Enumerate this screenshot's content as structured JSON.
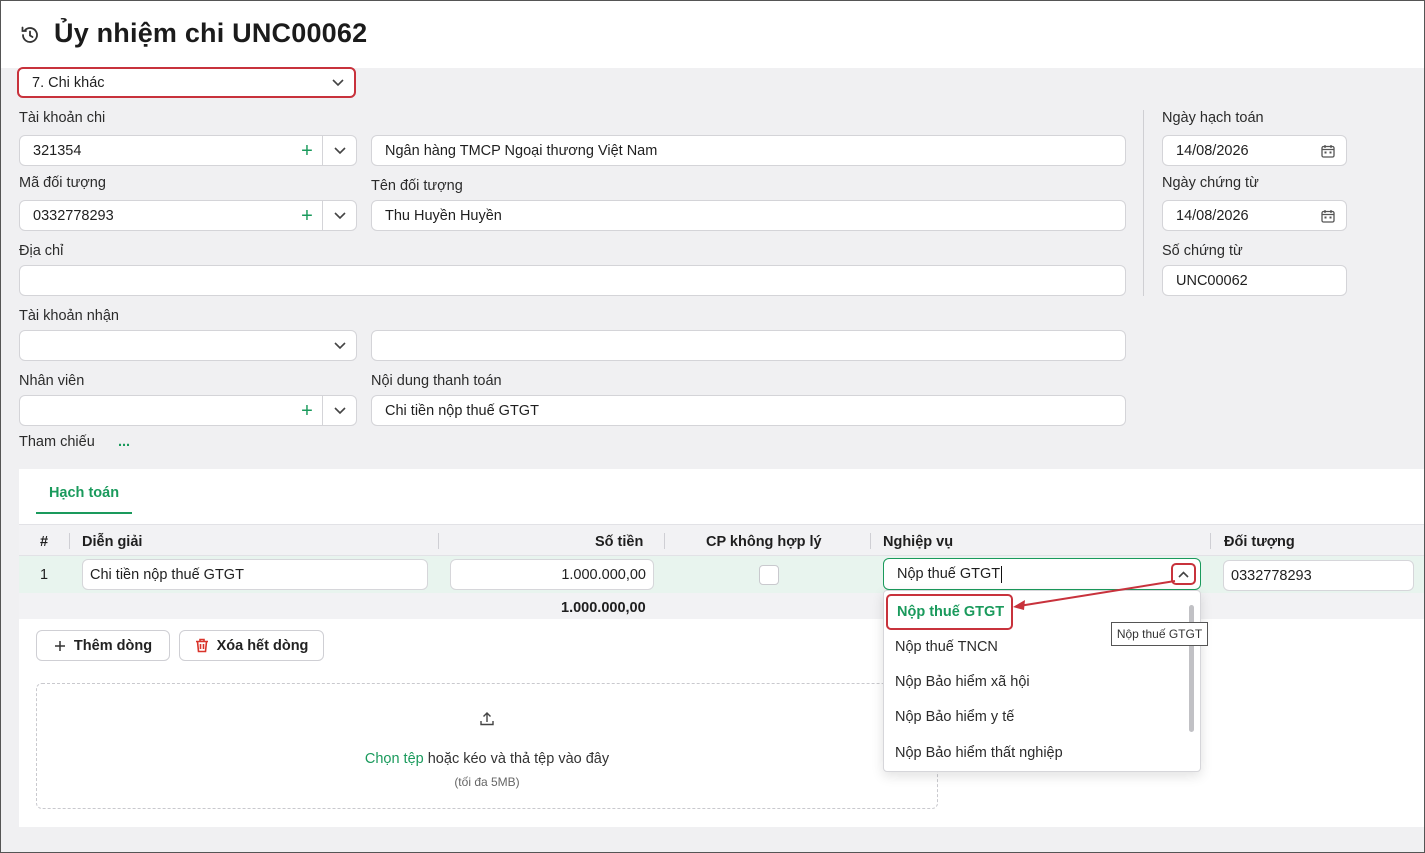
{
  "header": {
    "title": "Ủy nhiệm chi UNC00062"
  },
  "payment_type": {
    "value": "7. Chi khác"
  },
  "labels": {
    "tai_khoan_chi": "Tài khoản chi",
    "ma_doi_tuong": "Mã đối tượng",
    "ten_doi_tuong": "Tên đối tượng",
    "dia_chi": "Địa chỉ",
    "tai_khoan_nhan": "Tài khoản nhận",
    "nhan_vien": "Nhân viên",
    "noi_dung": "Nội dung thanh toán",
    "tham_chieu": "Tham chiếu",
    "tham_chieu_more": "...",
    "ngay_hach_toan": "Ngày hạch toán",
    "ngay_chung_tu": "Ngày chứng từ",
    "so_chung_tu": "Số chứng từ"
  },
  "form": {
    "tai_khoan_chi": "321354",
    "bank_name": "Ngân hàng TMCP Ngoại thương Việt Nam",
    "ma_doi_tuong": "0332778293",
    "ten_doi_tuong": "Thu Huyền Huyền",
    "dia_chi": "",
    "tai_khoan_nhan": "",
    "tai_khoan_nhan_detail": "",
    "nhan_vien": "",
    "noi_dung": "Chi tiền nộp thuế GTGT",
    "ngay_hach_toan": "14/08/2026",
    "ngay_chung_tu": "14/08/2026",
    "so_chung_tu": "UNC00062"
  },
  "tabs": [
    {
      "label": "Hạch toán",
      "active": true
    }
  ],
  "table": {
    "columns": [
      "#",
      "Diễn giải",
      "Số tiền",
      "CP không hợp lý",
      "Nghiệp vụ",
      "Đối tượng"
    ],
    "rows": [
      {
        "index": "1",
        "dien_giai": "Chi tiền nộp thuế GTGT",
        "so_tien": "1.000.000,00",
        "cp_khong_hop_ly": false,
        "nghiep_vu": "Nộp thuế GTGT",
        "doi_tuong": "0332778293"
      }
    ],
    "total": "1.000.000,00"
  },
  "buttons": {
    "add_row": "Thêm dòng",
    "delete_all": "Xóa hết dòng"
  },
  "upload": {
    "link": "Chọn tệp",
    "text": " hoặc kéo và thả tệp vào đây",
    "hint": "(tối đa 5MB)"
  },
  "dropdown": {
    "options": [
      "Nộp thuế GTGT",
      "Nộp thuế TNCN",
      "Nộp Bảo hiểm xã hội",
      "Nộp Bảo hiểm y tế",
      "Nộp Bảo hiểm thất nghiệp"
    ],
    "selected": "Nộp thuế GTGT"
  },
  "tooltip": "Nộp thuế GTGT",
  "colors": {
    "accent": "#1a9a5c",
    "highlight": "#c8323c",
    "row_active": "#e8f4ee"
  },
  "icons": [
    "history-icon",
    "chevron-down-icon",
    "plus-icon",
    "calendar-icon",
    "upload-icon",
    "trash-icon",
    "chevron-up-icon"
  ]
}
